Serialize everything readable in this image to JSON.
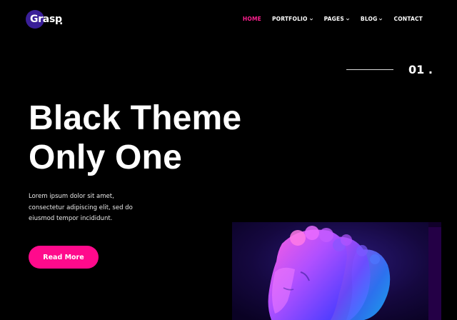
{
  "brand": {
    "name": "Grasp",
    "dot": "."
  },
  "nav": {
    "items": [
      {
        "label": "HOME",
        "active": true,
        "has_dropdown": false
      },
      {
        "label": "PORTFOLIO",
        "active": false,
        "has_dropdown": true
      },
      {
        "label": "PAGES",
        "active": false,
        "has_dropdown": true
      },
      {
        "label": "BLOG",
        "active": false,
        "has_dropdown": true
      },
      {
        "label": "CONTACT",
        "active": false,
        "has_dropdown": false
      }
    ]
  },
  "slide": {
    "number": "01 ."
  },
  "hero": {
    "title_line1": "Black Theme",
    "title_line2": "Only One",
    "description": "Lorem ipsum dolor sit amet, consectetur adipiscing elit, sed do eiusmod tempor incididunt.",
    "button_label": "Read More"
  },
  "colors": {
    "accent": "#ff0a8c",
    "nav_active": "#ff1f8f",
    "logo_circle": "#3a1f98",
    "background": "#000000"
  }
}
